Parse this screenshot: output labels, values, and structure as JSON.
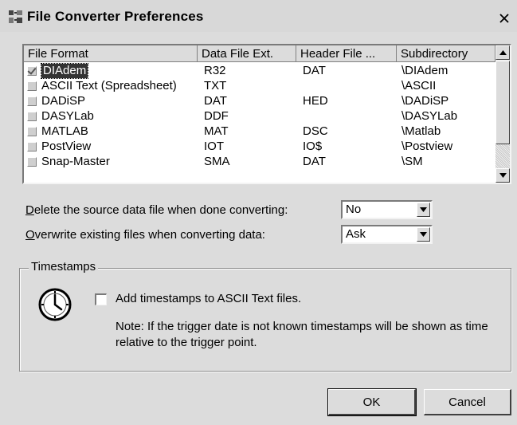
{
  "window": {
    "title": "File Converter Preferences"
  },
  "list": {
    "columns": [
      "File Format",
      "Data File Ext.",
      "Header File ...",
      "Subdirectory"
    ],
    "rows": [
      {
        "checked": true,
        "selected": true,
        "format": "DIAdem",
        "data_ext": "R32",
        "header_ext": "DAT",
        "subdir": "\\DIAdem"
      },
      {
        "checked": false,
        "selected": false,
        "format": "ASCII Text (Spreadsheet)",
        "data_ext": "TXT",
        "header_ext": "",
        "subdir": "\\ASCII"
      },
      {
        "checked": false,
        "selected": false,
        "format": "DADiSP",
        "data_ext": "DAT",
        "header_ext": "HED",
        "subdir": "\\DADiSP"
      },
      {
        "checked": false,
        "selected": false,
        "format": "DASYLab",
        "data_ext": "DDF",
        "header_ext": "",
        "subdir": "\\DASYLab"
      },
      {
        "checked": false,
        "selected": false,
        "format": "MATLAB",
        "data_ext": "MAT",
        "header_ext": "DSC",
        "subdir": "\\Matlab"
      },
      {
        "checked": false,
        "selected": false,
        "format": "PostView",
        "data_ext": "IOT",
        "header_ext": "IO$",
        "subdir": "\\Postview"
      },
      {
        "checked": false,
        "selected": false,
        "format": "Snap-Master",
        "data_ext": "SMA",
        "header_ext": "DAT",
        "subdir": "\\SM"
      }
    ]
  },
  "options": {
    "delete_source": {
      "label_underline": "D",
      "label_rest": "elete the source data file when done converting:",
      "value": "No"
    },
    "overwrite": {
      "label_underline": "O",
      "label_rest": "verwrite existing files when converting data:",
      "value": "Ask"
    }
  },
  "timestamps": {
    "group_title": "Timestamps",
    "checkbox_label": "Add timestamps to ASCII Text files.",
    "checked": false,
    "note": "Note: If the trigger date is not known timestamps will be shown as time relative to the trigger point."
  },
  "buttons": {
    "ok": "OK",
    "cancel": "Cancel"
  }
}
